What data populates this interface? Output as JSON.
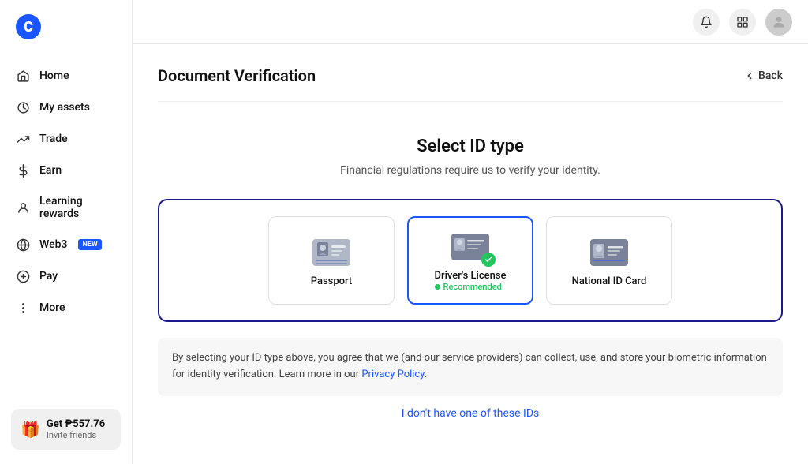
{
  "sidebar": {
    "logo_letter": "C",
    "nav_items": [
      {
        "id": "home",
        "label": "Home",
        "icon": "home"
      },
      {
        "id": "my-assets",
        "label": "My assets",
        "icon": "assets"
      },
      {
        "id": "trade",
        "label": "Trade",
        "icon": "trade"
      },
      {
        "id": "earn",
        "label": "Earn",
        "icon": "earn"
      },
      {
        "id": "learning-rewards",
        "label": "Learning rewards",
        "icon": "learning"
      },
      {
        "id": "web3",
        "label": "Web3",
        "icon": "web3",
        "badge": "NEW"
      },
      {
        "id": "pay",
        "label": "Pay",
        "icon": "pay"
      },
      {
        "id": "more",
        "label": "More",
        "icon": "more"
      }
    ],
    "invite_card": {
      "title": "Get ₱557.76",
      "subtitle": "Invite friends"
    }
  },
  "topbar": {
    "bell_icon": "bell",
    "grid_icon": "grid",
    "avatar_icon": "user"
  },
  "page": {
    "title": "Document Verification",
    "back_label": "Back",
    "select_id": {
      "title": "Select ID type",
      "subtitle": "Financial regulations require us to verify your identity.",
      "options": [
        {
          "id": "passport",
          "label": "Passport",
          "recommended": false
        },
        {
          "id": "drivers-license",
          "label": "Driver's License",
          "recommended": true,
          "recommended_text": "Recommended"
        },
        {
          "id": "national-id",
          "label": "National ID Card",
          "recommended": false
        }
      ]
    },
    "disclaimer": {
      "text": "By selecting your ID type above, you agree that we (and our service providers) can collect, use, and store your biometric information for identity verification. Learn more in our ",
      "link_text": "Privacy Policy",
      "text_after": "."
    },
    "no_id_link": "I don't have one of these IDs"
  }
}
